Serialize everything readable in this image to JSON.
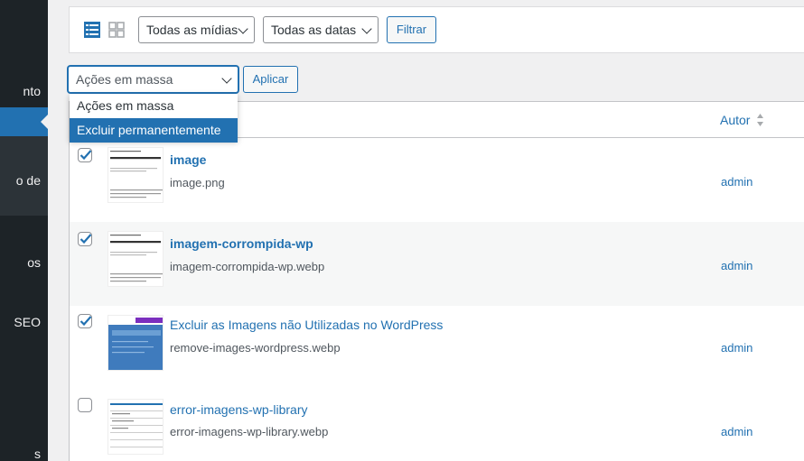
{
  "sidebar": {
    "items": [
      {
        "label": "nto"
      },
      {
        "label": "o de"
      },
      {
        "label": "os"
      },
      {
        "label": "SEO"
      },
      {
        "label": "s"
      }
    ]
  },
  "toolbar": {
    "media_filter": "Todas as mídias",
    "date_filter": "Todas as datas",
    "filter_button": "Filtrar"
  },
  "bulk": {
    "select_value": "Ações em massa",
    "apply_button": "Aplicar",
    "options": [
      "Ações em massa",
      "Excluir permanentemente"
    ],
    "highlighted_option": "Excluir permanentemente"
  },
  "table": {
    "columns": {
      "author": "Autor"
    },
    "rows": [
      {
        "checked": true,
        "title": "image",
        "filename": "image.png",
        "author": "admin"
      },
      {
        "checked": true,
        "title": "imagem-corrompida-wp",
        "filename": "imagem-corrompida-wp.webp",
        "author": "admin"
      },
      {
        "checked": true,
        "title": "Excluir as Imagens não Utilizadas no WordPress",
        "filename": "remove-images-wordpress.webp",
        "author": "admin"
      },
      {
        "checked": false,
        "title": "error-imagens-wp-library",
        "filename": "error-imagens-wp-library.webp",
        "author": "admin"
      }
    ]
  },
  "colors": {
    "accent": "#2271b1",
    "sidebar_bg": "#1d2327",
    "page_bg": "#f0f0f1"
  },
  "icons": {
    "list_view": "list-view-icon",
    "grid_view": "grid-view-icon",
    "sort": "sort-icon",
    "check": "check-icon"
  }
}
